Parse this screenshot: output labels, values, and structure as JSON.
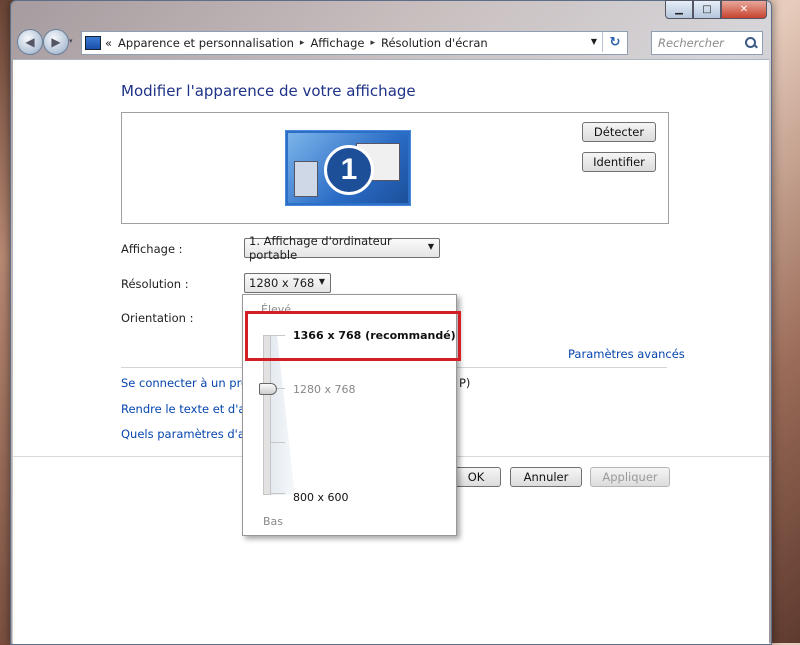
{
  "window": {
    "caption": {
      "minimize": "▁",
      "maximize": "□",
      "close": "✕"
    }
  },
  "nav": {
    "back_icon": "arrow-left-icon",
    "forward_icon": "arrow-right-icon",
    "history_glyph": "▾",
    "overflow": "«",
    "breadcrumb": [
      "Apparence et personnalisation",
      "Affichage",
      "Résolution d'écran"
    ],
    "separator": "▸",
    "dropdown_glyph": "▼",
    "refresh_glyph": "↻",
    "search_placeholder": "Rechercher"
  },
  "main": {
    "title": "Modifier l'apparence de votre affichage",
    "monitor_number": "1",
    "detect_label": "Détecter",
    "identify_label": "Identifier",
    "display_label": "Affichage :",
    "display_value": "1. Affichage d'ordinateur portable",
    "resolution_label": "Résolution :",
    "resolution_value": "1280 x 768",
    "orientation_label": "Orientation :",
    "advanced_link": "Paramètres avancés",
    "links": [
      "Se connecter à un proje",
      "Rendre le texte et d'autre",
      "Quels paramètres d'affic"
    ],
    "link_tail": "P)",
    "ok_label": "OK",
    "cancel_label": "Annuler",
    "apply_label": "Appliquer"
  },
  "resolution_popup": {
    "high_label": "Élevé",
    "recommended": "1366 x 768 (recommandé)",
    "current": "1280 x 768",
    "minimum": "800 x 600",
    "low_label": "Bas"
  },
  "colors": {
    "title": "#1e3287",
    "link": "#0645ad",
    "highlight": "#d21f26"
  }
}
